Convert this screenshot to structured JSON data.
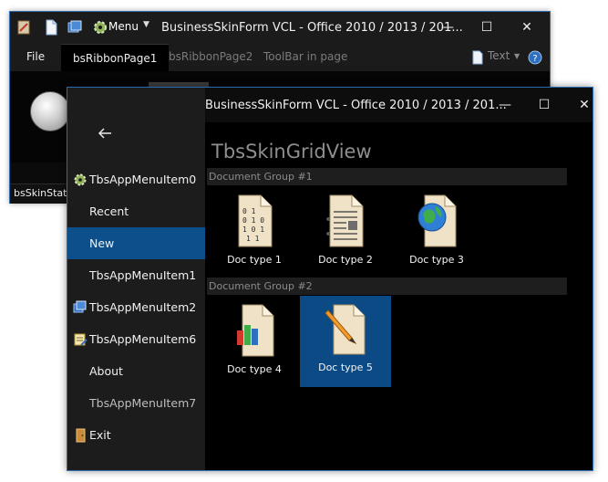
{
  "back_window": {
    "menu_label": "Menu",
    "title": "BusinessSkinForm VCL - Office 2010 / 2013 / 201...",
    "tabs": [
      "File",
      "bsRibbonPage1",
      "bsRibbonPage2",
      "ToolBar in page"
    ],
    "text_button": "Text",
    "status": "bsSkinStatus"
  },
  "front_window": {
    "title": "BusinessSkinForm VCL - Office 2010 / 2013 / 201...",
    "menu_items": [
      {
        "label": "TbsAppMenuItem0",
        "icon": "gear-icon"
      },
      {
        "label": "Recent",
        "icon": ""
      },
      {
        "label": "New",
        "icon": "",
        "selected": true
      },
      {
        "label": "TbsAppMenuItem1",
        "icon": ""
      },
      {
        "label": "TbsAppMenuItem2",
        "icon": "windows-icon"
      },
      {
        "label": "TbsAppMenuItem6",
        "icon": "document-edit-icon"
      },
      {
        "label": "About",
        "icon": ""
      },
      {
        "label": "TbsAppMenuItem7",
        "icon": ""
      },
      {
        "label": "Exit",
        "icon": "door-exit-icon"
      }
    ],
    "grid": {
      "title": "TbsSkinGridView",
      "groups": [
        {
          "header": "Document Group #1",
          "items": [
            "Doc type 1",
            "Doc type 2",
            "Doc type 3"
          ]
        },
        {
          "header": "Document Group #2",
          "items": [
            "Doc type 4",
            "Doc type 5"
          ]
        }
      ],
      "selected_item": "Doc type 5"
    }
  },
  "colors": {
    "accent": "#0d4f8b",
    "window_border": "#2a6bb0",
    "sidebar_bg": "#1c1c1c",
    "content_bg": "#000000"
  }
}
